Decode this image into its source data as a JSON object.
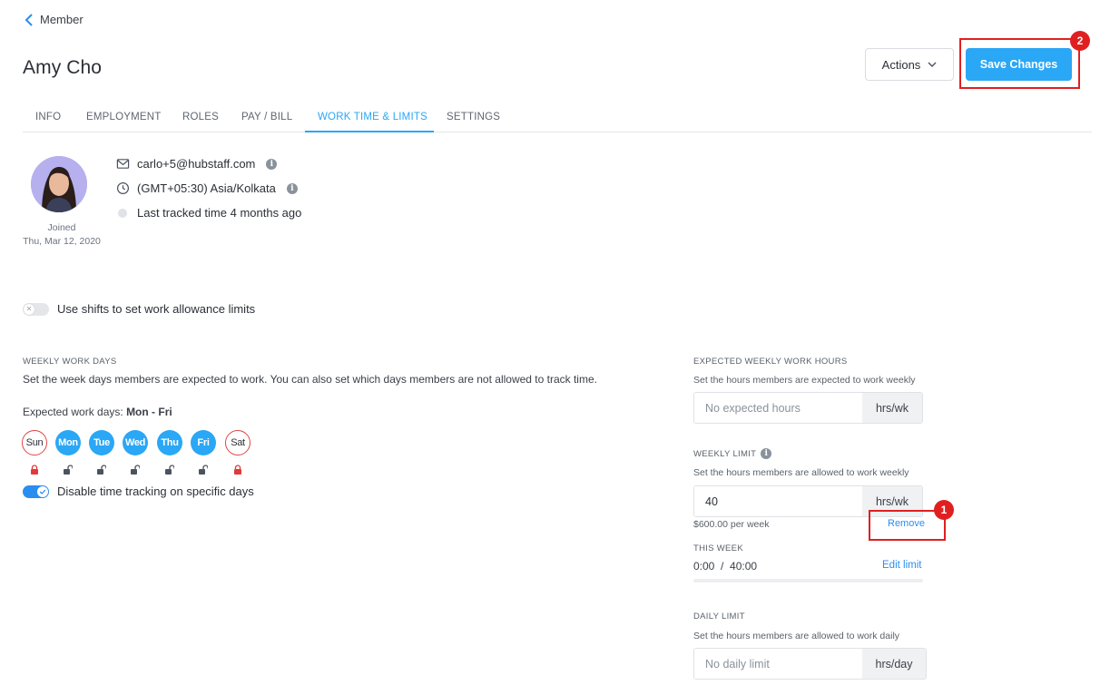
{
  "nav": {
    "back_label": "Member"
  },
  "header": {
    "title": "Amy Cho",
    "actions_label": "Actions",
    "save_label": "Save Changes"
  },
  "annotations": {
    "badge_1": "1",
    "badge_2": "2"
  },
  "tabs": [
    {
      "label": "INFO",
      "active": false
    },
    {
      "label": "EMPLOYMENT",
      "active": false
    },
    {
      "label": "ROLES",
      "active": false
    },
    {
      "label": "PAY / BILL",
      "active": false
    },
    {
      "label": "WORK TIME & LIMITS",
      "active": true
    },
    {
      "label": "SETTINGS",
      "active": false
    }
  ],
  "profile": {
    "email": "carlo+5@hubstaff.com",
    "timezone": "(GMT+05:30) Asia/Kolkata",
    "last_tracked": "Last tracked time 4 months ago",
    "joined_label": "Joined",
    "joined_date": "Thu, Mar 12, 2020"
  },
  "shifts_toggle": {
    "label": "Use shifts to set work allowance limits",
    "on": false
  },
  "weekly_days": {
    "title": "WEEKLY WORK DAYS",
    "description": "Set the week days members are expected to work. You can also set which days members are not allowed to track time.",
    "expected_label": "Expected work days: ",
    "expected_value": "Mon - Fri",
    "days": [
      {
        "label": "Sun",
        "on": false,
        "locked": true
      },
      {
        "label": "Mon",
        "on": true,
        "locked": false
      },
      {
        "label": "Tue",
        "on": true,
        "locked": false
      },
      {
        "label": "Wed",
        "on": true,
        "locked": false
      },
      {
        "label": "Thu",
        "on": true,
        "locked": false
      },
      {
        "label": "Fri",
        "on": true,
        "locked": false
      },
      {
        "label": "Sat",
        "on": false,
        "locked": true
      }
    ],
    "disable_toggle": {
      "label": "Disable time tracking on specific days",
      "on": true
    }
  },
  "expected_hours": {
    "title": "EXPECTED WEEKLY WORK HOURS",
    "description": "Set the hours members are expected to work weekly",
    "placeholder": "No expected hours",
    "value": "",
    "unit": "hrs/wk"
  },
  "weekly_limit": {
    "title": "WEEKLY LIMIT",
    "description": "Set the hours members are allowed to work weekly",
    "value": "40",
    "unit": "hrs/wk",
    "cost": "$600.00 per week",
    "remove_label": "Remove",
    "this_week_label": "THIS WEEK",
    "this_week_value": "0:00  /  40:00",
    "progress": 0,
    "edit_label": "Edit limit"
  },
  "daily_limit": {
    "title": "DAILY LIMIT",
    "description": "Set the hours members are allowed to work daily",
    "placeholder": "No daily limit",
    "value": "",
    "unit": "hrs/day"
  },
  "colors": {
    "accent": "#2aa7f5",
    "highlight": "#e02020",
    "lock_red": "#e03a3a"
  },
  "icons": [
    "chevron-left-icon",
    "chevron-down-icon",
    "envelope-icon",
    "clock-icon",
    "info-icon",
    "lock-icon",
    "unlock-icon",
    "check-icon"
  ]
}
